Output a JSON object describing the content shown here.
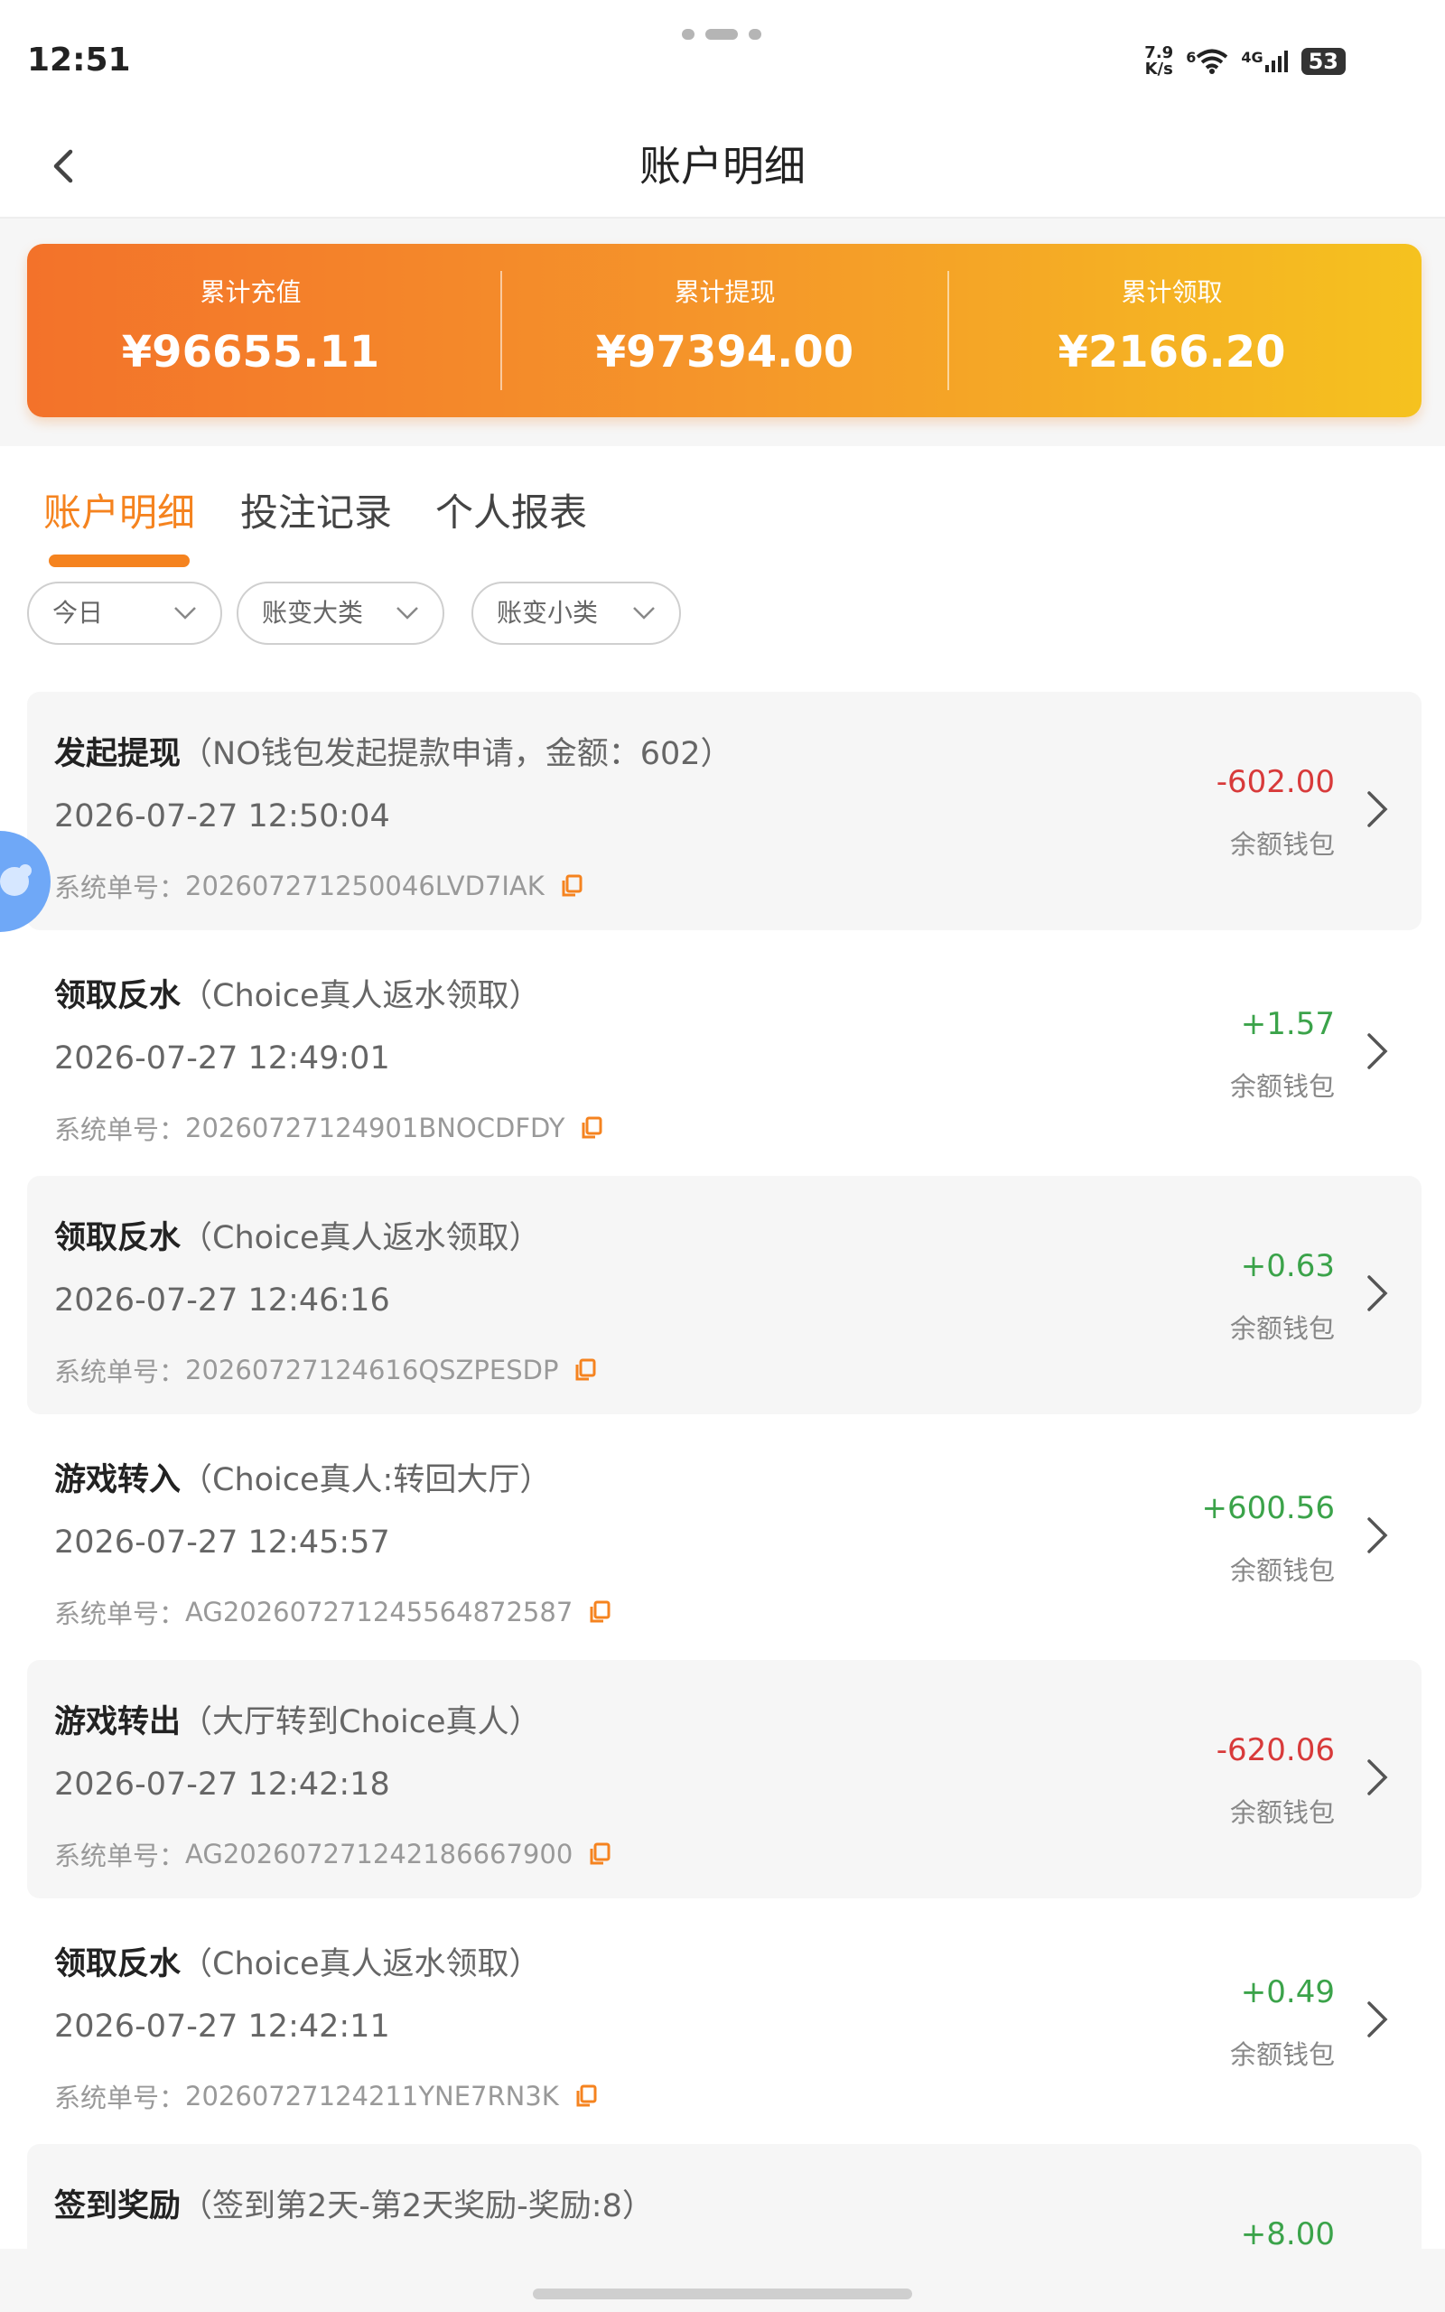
{
  "status_bar": {
    "time": "12:51",
    "net_speed_value": "7.9",
    "net_speed_unit": "K/s",
    "wifi_badge": "6",
    "cell_badge": "4G",
    "battery": "53"
  },
  "header": {
    "title": "账户明细"
  },
  "summary": [
    {
      "label": "累计充值",
      "value": "¥96655.11"
    },
    {
      "label": "累计提现",
      "value": "¥97394.00"
    },
    {
      "label": "累计领取",
      "value": "¥2166.20"
    }
  ],
  "tabs": [
    {
      "label": "账户明细",
      "active": true
    },
    {
      "label": "投注记录",
      "active": false
    },
    {
      "label": "个人报表",
      "active": false
    }
  ],
  "filters": [
    {
      "label": "今日"
    },
    {
      "label": "账变大类"
    },
    {
      "label": "账变小类"
    }
  ],
  "records": [
    {
      "type": "发起提现",
      "detail": "（NO钱包发起提款申请，金额：602）",
      "time": "2026-07-27 12:50:04",
      "order_label": "系统单号：",
      "order_no": "202607271250046LVD7IAK",
      "amount": "-602.00",
      "wallet": "余额钱包"
    },
    {
      "type": "领取反水",
      "detail": "（Choice真人返水领取）",
      "time": "2026-07-27 12:49:01",
      "order_label": "系统单号：",
      "order_no": "20260727124901BNOCDFDY",
      "amount": "+1.57",
      "wallet": "余额钱包"
    },
    {
      "type": "领取反水",
      "detail": "（Choice真人返水领取）",
      "time": "2026-07-27 12:46:16",
      "order_label": "系统单号：",
      "order_no": "20260727124616QSZPESDP",
      "amount": "+0.63",
      "wallet": "余额钱包"
    },
    {
      "type": "游戏转入",
      "detail": "（Choice真人:转回大厅）",
      "time": "2026-07-27 12:45:57",
      "order_label": "系统单号：",
      "order_no": "AG202607271245564872587",
      "amount": "+600.56",
      "wallet": "余额钱包"
    },
    {
      "type": "游戏转出",
      "detail": "（大厅转到Choice真人）",
      "time": "2026-07-27 12:42:18",
      "order_label": "系统单号：",
      "order_no": "AG202607271242186667900",
      "amount": "-620.06",
      "wallet": "余额钱包"
    },
    {
      "type": "领取反水",
      "detail": "（Choice真人返水领取）",
      "time": "2026-07-27 12:42:11",
      "order_label": "系统单号：",
      "order_no": "20260727124211YNE7RN3K",
      "amount": "+0.49",
      "wallet": "余额钱包"
    },
    {
      "type": "签到奖励",
      "detail": "（签到第2天-第2天奖励-奖励:8）",
      "time": "",
      "order_label": "",
      "order_no": "",
      "amount": "+8.00",
      "wallet": ""
    }
  ]
}
